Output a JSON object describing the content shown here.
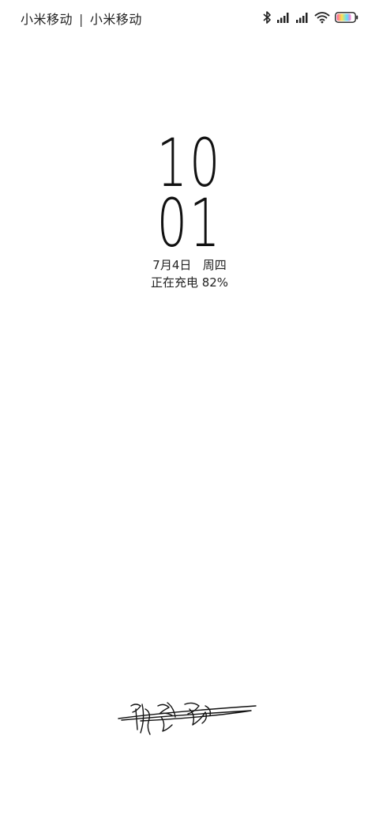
{
  "status_bar": {
    "carrier_1": "小米移动",
    "separator": "|",
    "carrier_2": "小米移动",
    "icons": [
      "bluetooth-icon",
      "signal-icon",
      "signal-icon",
      "wifi-icon",
      "battery-icon"
    ],
    "battery_level": 0.82
  },
  "lock_screen": {
    "hour": "10",
    "minute": "01",
    "date": "7月4日   周四",
    "charging_status": "正在充电 82%"
  },
  "signature": {
    "icon": "signature-icon"
  }
}
